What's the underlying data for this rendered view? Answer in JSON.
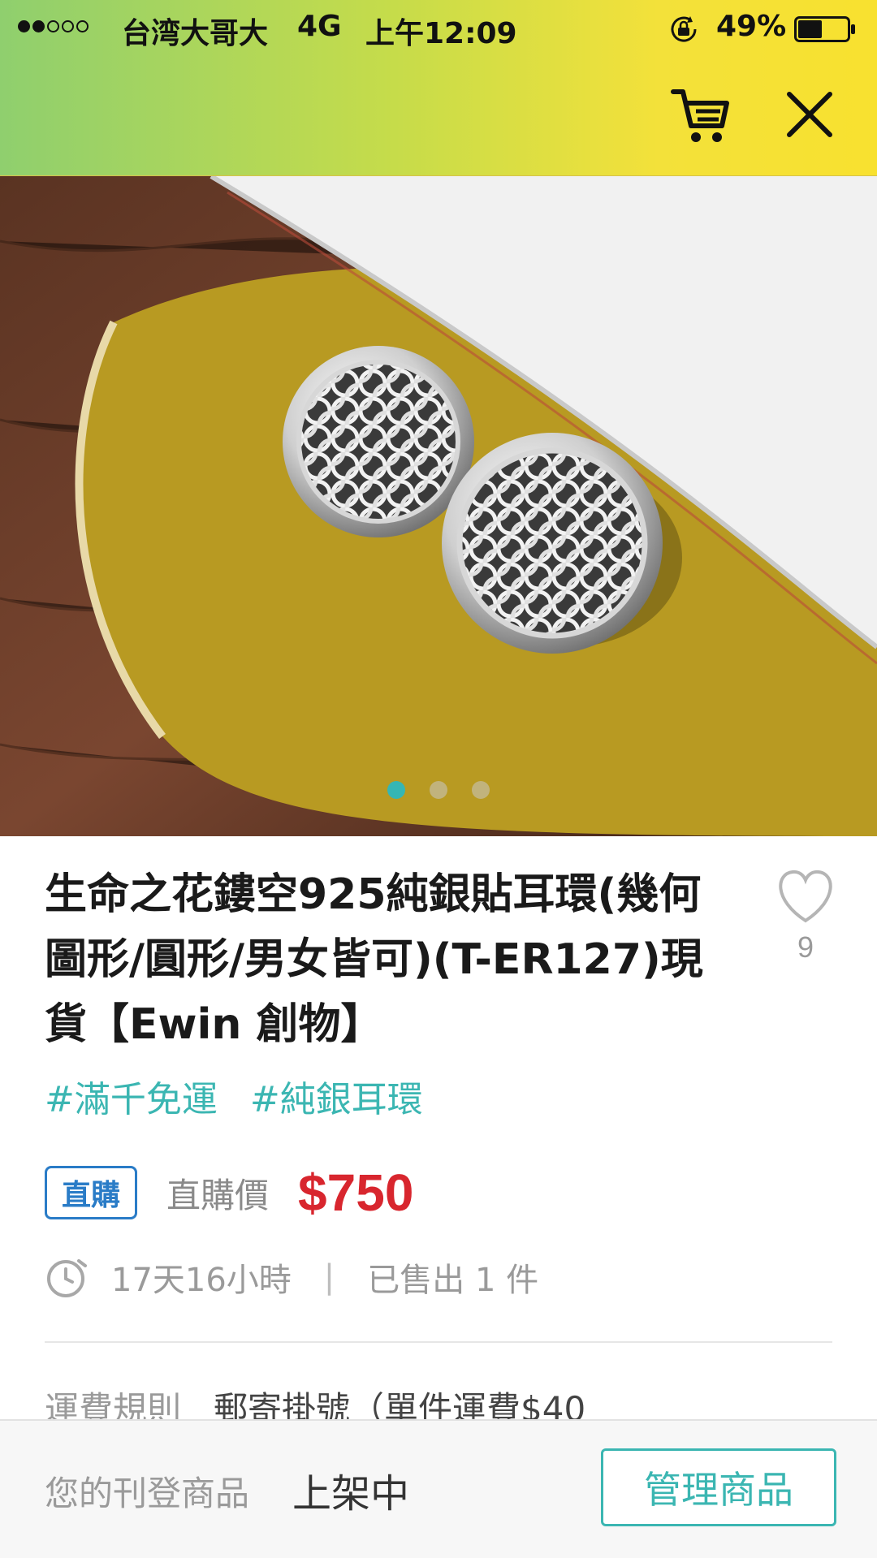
{
  "status_bar": {
    "carrier": "台湾大哥大",
    "network": "4G",
    "time": "上午12:09",
    "battery": "49%",
    "battery_level": 0.49
  },
  "nav": {
    "cart_icon": "cart-icon",
    "close_icon": "close-icon"
  },
  "carousel": {
    "total": 3,
    "active_index": 0
  },
  "product": {
    "title": "生命之花鏤空925純銀貼耳環(幾何圖形/圓形/男女皆可)(T-ER127)現貨【Ewin 創物】",
    "favorite_count": "9",
    "tags": [
      "#滿千免運",
      "#純銀耳環"
    ],
    "purchase_badge": "直購",
    "price_label": "直購價",
    "price": "$750",
    "time_left": "17天16小時",
    "sold": "已售出 1 件",
    "shipping_label": "運費規則",
    "shipping_value": "郵寄掛號（單件運費$40"
  },
  "bottom_bar": {
    "listing_label": "您的刊登商品",
    "listing_status": "上架中",
    "manage_button": "管理商品"
  },
  "colors": {
    "accent": "#3bb6b2",
    "price": "#d8262e",
    "badge": "#2a7cc7"
  }
}
